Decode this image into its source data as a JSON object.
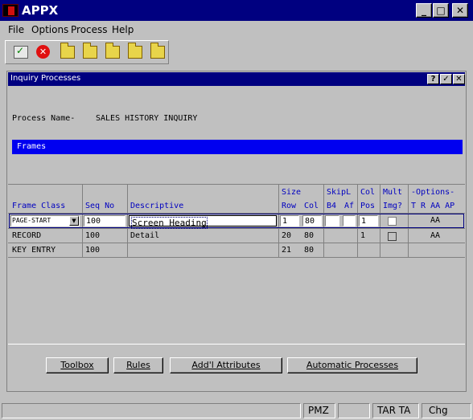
{
  "app": {
    "title": "APPX"
  },
  "menu": {
    "items": [
      "File",
      "Options",
      "Process",
      "Help"
    ]
  },
  "inner_window": {
    "title": "Inquiry Processes"
  },
  "process": {
    "label": "Process Name-",
    "value": "SALES HISTORY INQUIRY"
  },
  "frames_bar": {
    "label": "Frames"
  },
  "table": {
    "headers": {
      "frame_class": "Frame Class",
      "seq_no": "Seq No",
      "descriptive": "Descriptive",
      "size_top": "Size",
      "size_row": "Row",
      "size_col": "Col",
      "skip_top": "SkipL",
      "skip_b4": "B4",
      "skip_af": "Af",
      "col_top": "Col",
      "col_pos": "Pos",
      "mult_top": "Mult",
      "mult_img": "Img?",
      "options_top": "-Options-",
      "options_sub": "T R AA AP"
    },
    "rows": [
      {
        "frame_class": "PAGE-START",
        "seq": "100",
        "desc": "Screen Heading",
        "row": "1",
        "col": "80",
        "pos": "1",
        "opt": "AA"
      },
      {
        "frame_class": "RECORD",
        "seq": "100",
        "desc": "Detail",
        "row": "20",
        "col": "80",
        "pos": "1",
        "opt": "AA"
      },
      {
        "frame_class": "KEY ENTRY",
        "seq": "100",
        "desc": "",
        "row": "21",
        "col": "80",
        "pos": "",
        "opt": ""
      }
    ]
  },
  "buttons": {
    "toolbox": "Toolbox",
    "rules": "Rules",
    "addl": "Add'l Attributes",
    "auto": "Automatic Processes"
  },
  "status": {
    "pmz": "PMZ",
    "tar": "TAR TA",
    "chg": "Chg"
  },
  "colors": {
    "title_bar": "#000080",
    "selection_bar": "#0000f0",
    "header_text": "#0000c0"
  }
}
